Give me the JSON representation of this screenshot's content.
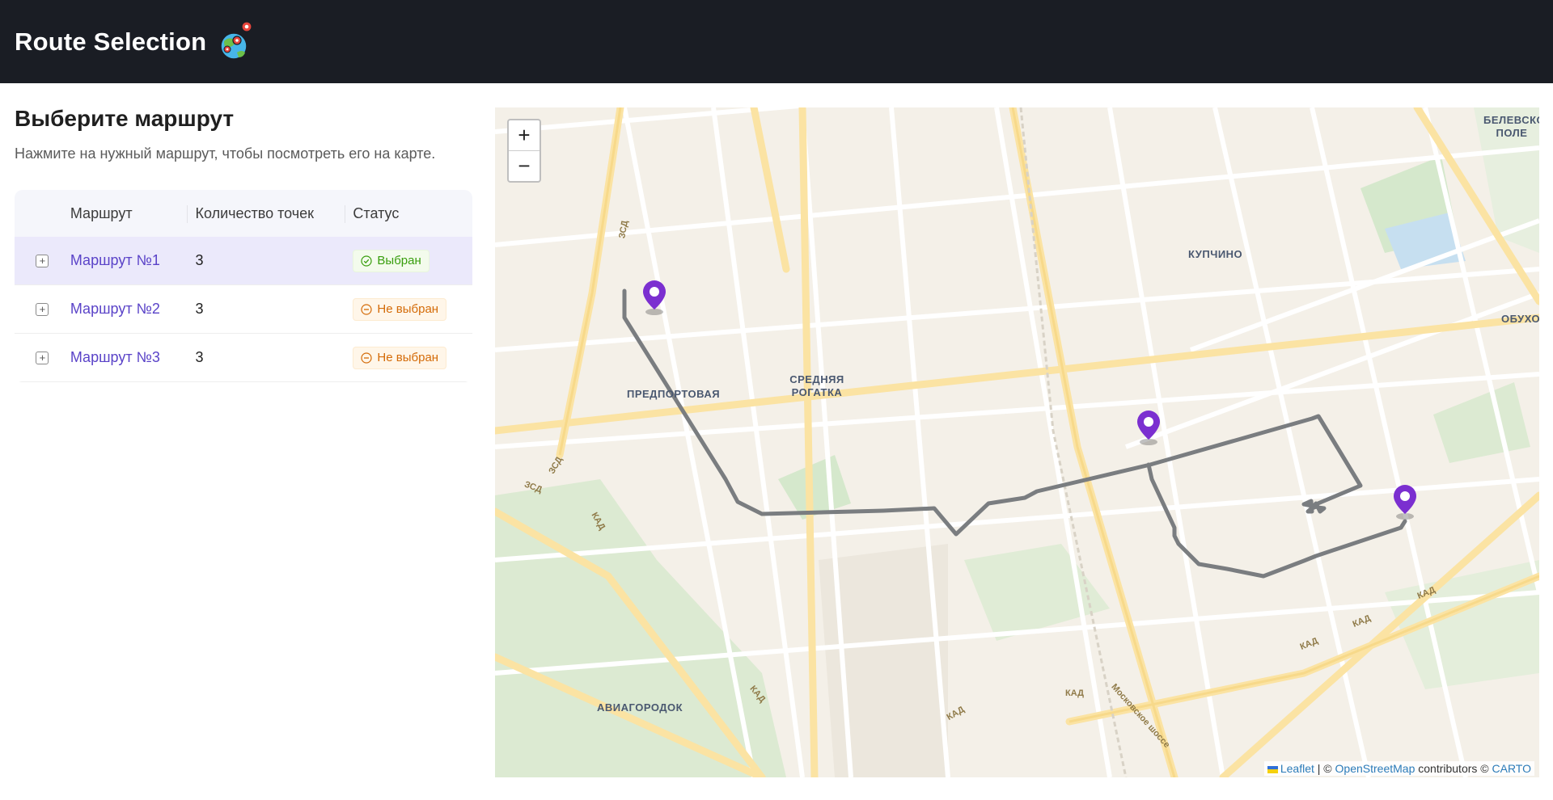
{
  "header": {
    "title": "Route Selection",
    "logo_icon": "globe-map-pins-icon"
  },
  "panel": {
    "title": "Выберите маршрут",
    "subtitle": "Нажмите на нужный маршрут, чтобы посмотреть его на карте."
  },
  "table": {
    "columns": [
      "Маршрут",
      "Количество точек",
      "Статус"
    ],
    "rows": [
      {
        "name": "Маршрут №1",
        "points": "3",
        "status": "Выбран",
        "selected": true
      },
      {
        "name": "Маршрут №2",
        "points": "3",
        "status": "Не выбран",
        "selected": false
      },
      {
        "name": "Маршрут №3",
        "points": "3",
        "status": "Не выбран",
        "selected": false
      }
    ]
  },
  "map": {
    "zoom_in": "+",
    "zoom_out": "−",
    "places": [
      "БЕЛЕВСКОЕ ПОЛЕ",
      "КУПЧИНО",
      "ОБУХОВО",
      "ПРЕДПОРТОВАЯ",
      "СРЕДНЯЯ РОГАТКА",
      "АВИАГОРОДОК"
    ],
    "roads": [
      "ЗСД",
      "ЗСД",
      "ЗСД",
      "КАД",
      "КАД",
      "КАД",
      "КАД",
      "КАД",
      "КАД",
      "КАД",
      "Московское шоссе"
    ],
    "attribution": {
      "leaflet": "Leaflet",
      "sep": "| ©",
      "osm": "OpenStreetMap",
      "contributors": "contributors ©",
      "carto": "CARTO"
    },
    "route_color": "#7a7d80",
    "marker_color": "#7b2fd0"
  },
  "colors": {
    "accent": "#5a43c8",
    "header_bg": "#1a1d24",
    "selected_row": "#ebe9fb"
  }
}
